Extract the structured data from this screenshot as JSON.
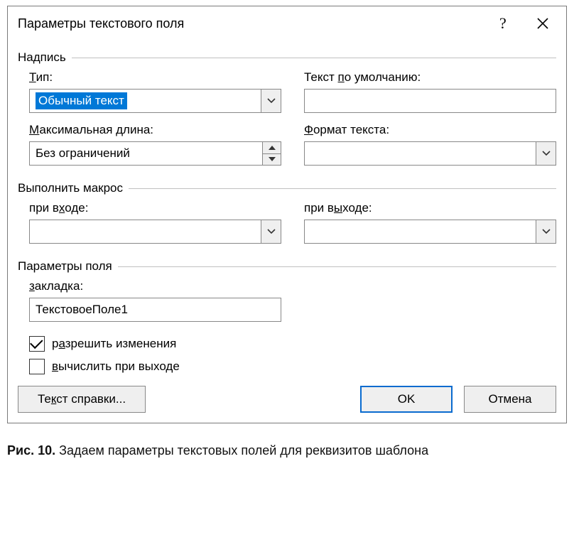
{
  "dialog": {
    "title": "Параметры текстового поля",
    "groups": {
      "inscription": {
        "legend": "Надпись",
        "type_label_pre": "Т",
        "type_label_post": "ип:",
        "type_value": "Обычный текст",
        "default_label_pre": "Текст ",
        "default_label_u": "п",
        "default_label_post": "о умолчанию:",
        "default_value": "",
        "maxlen_label_u": "М",
        "maxlen_label_post": "аксимальная длина:",
        "maxlen_value": "Без ограничений",
        "format_label_u": "Ф",
        "format_label_post": "ормат текста:",
        "format_value": ""
      },
      "macro": {
        "legend": "Выполнить макрос",
        "entry_label_pre": "при в",
        "entry_label_u": "х",
        "entry_label_post": "оде:",
        "entry_value": "",
        "exit_label_pre": "при в",
        "exit_label_u": "ы",
        "exit_label_post": "ходе:",
        "exit_value": ""
      },
      "field": {
        "legend": "Параметры поля",
        "bookmark_label_u": "з",
        "bookmark_label_post": "акладка:",
        "bookmark_value": "ТекстовоеПоле1",
        "allow_changes_checked": true,
        "allow_changes_pre": "р",
        "allow_changes_u": "а",
        "allow_changes_post": "зрешить изменения",
        "calc_on_exit_checked": false,
        "calc_on_exit_u": "в",
        "calc_on_exit_post": "ычислить при выходе"
      }
    },
    "buttons": {
      "help_pre": "Те",
      "help_u": "к",
      "help_post": "ст справки...",
      "ok": "OK",
      "cancel": "Отмена"
    }
  },
  "caption": {
    "prefix": "Рис. 10.",
    "text": " Задаем параметры текстовых полей для реквизитов шаблона"
  }
}
